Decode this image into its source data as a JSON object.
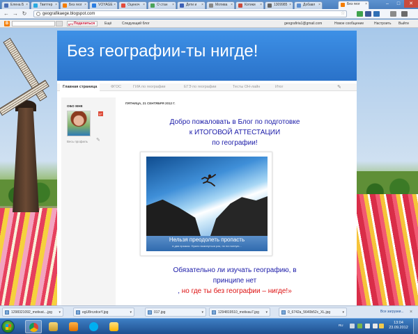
{
  "browser": {
    "tabs": [
      {
        "label": "Елена Б",
        "icon_color": "#4a6fb5"
      },
      {
        "label": "Твиттер",
        "icon_color": "#2aa9e0"
      },
      {
        "label": "Без геог",
        "icon_color": "#f57d00"
      },
      {
        "label": "VOYAGE",
        "icon_color": "#2a7de1"
      },
      {
        "label": "Оценоч",
        "icon_color": "#e34b3c"
      },
      {
        "label": "О стан",
        "icon_color": "#4aa35a"
      },
      {
        "label": "Дети и",
        "icon_color": "#3b5fb5"
      },
      {
        "label": "Мотива",
        "icon_color": "#888888"
      },
      {
        "label": "Котики",
        "icon_color": "#c94b3c"
      },
      {
        "label": "1309985",
        "icon_color": "#666666"
      },
      {
        "label": "Добавл",
        "icon_color": "#5e8fd0"
      },
      {
        "label": "Без геог",
        "icon_color": "#f57d00"
      }
    ],
    "url": "geografikaege.blogspot.com",
    "window_controls": {
      "minimize": "–",
      "maximize": "□",
      "close": "✕"
    }
  },
  "blogger_nav": {
    "share_label": "Поделиться",
    "more_label": "Ещё",
    "next_blog_label": "Следующий блог",
    "email": "geografiria1@gmail.com",
    "new_post_label": "Новое сообщение",
    "design_label": "Настроить",
    "exit_label": "Выйти"
  },
  "blog": {
    "title": "Без географии-ты нигде!",
    "tabs": [
      "Главная страница",
      "ФГОС",
      "ГИА по географии",
      "ЕГЭ по географии",
      "Тесты ОН-лайн",
      "Итог"
    ],
    "active_tab": "Главная страница"
  },
  "sidebar": {
    "about_title": "ОБО МНЕ",
    "profile_link": "Весь профиль"
  },
  "post": {
    "date": "ПЯТНИЦА, 21 СЕНТЯБРЯ 2012 Г.",
    "welcome_line1": "Добро пожаловать в Блог по подготовке",
    "welcome_line2": "к ИТОГОВОЙ АТТЕСТАЦИИ",
    "welcome_line3": "по географии!",
    "image_caption": "Нельзя преодолеть пропасть",
    "image_subcaption": "в два прыжка. Нужно выкинуться раз, но на полную...",
    "question_line1": "Обязательно ли изучать географию, в",
    "question_line2": "принципе нет",
    "question_comma": ", ",
    "question_red": "но где ты без географии – нигде!",
    "question_end": "»"
  },
  "downloads": {
    "items": [
      "1298321092_motivat....jpg",
      "egU8rczdceY.jpg",
      "017.jpg",
      "1294819510_motivau7.jpg",
      "0_6742a_5640b52c_XL.jpg"
    ],
    "show_all_label": "Все загрузки..."
  },
  "taskbar": {
    "language": "RU",
    "time": "13:04",
    "date": "23.09.2012"
  }
}
